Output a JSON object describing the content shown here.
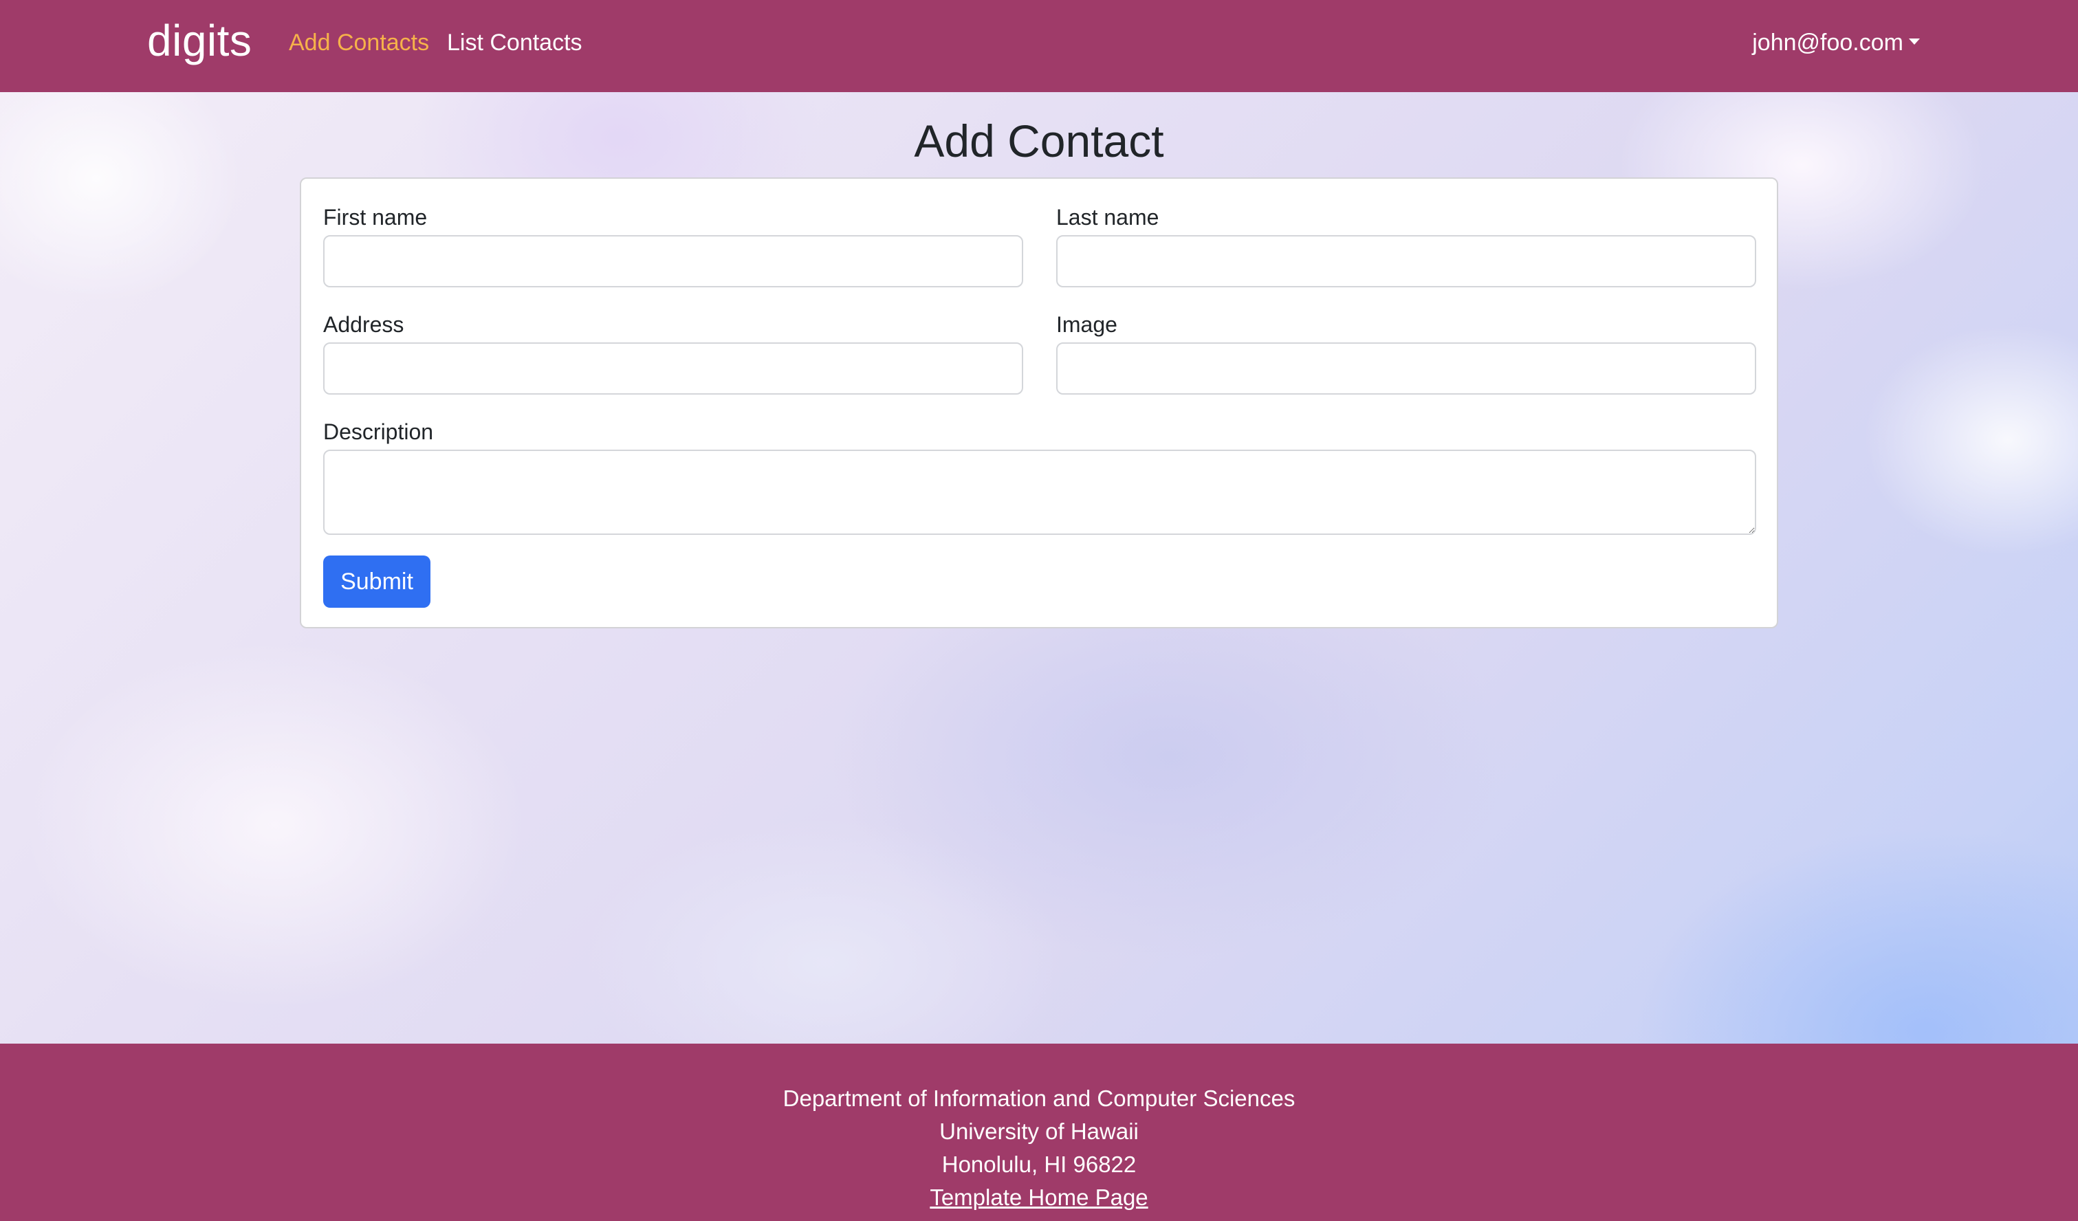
{
  "navbar": {
    "brand": "digits",
    "links": [
      {
        "label": "Add Contacts",
        "active": true
      },
      {
        "label": "List Contacts",
        "active": false
      }
    ],
    "user": "john@foo.com"
  },
  "page": {
    "title": "Add Contact"
  },
  "form": {
    "first_name": {
      "label": "First name",
      "value": ""
    },
    "last_name": {
      "label": "Last name",
      "value": ""
    },
    "address": {
      "label": "Address",
      "value": ""
    },
    "image": {
      "label": "Image",
      "value": ""
    },
    "description": {
      "label": "Description",
      "value": ""
    },
    "submit_label": "Submit"
  },
  "footer": {
    "line1": "Department of Information and Computer Sciences",
    "line2": "University of Hawaii",
    "line3": "Honolulu, HI 96822",
    "link": "Template Home Page"
  },
  "colors": {
    "brand_bar": "#9f3b69",
    "active_link": "#f6b24a",
    "primary_button": "#2f6ff2"
  }
}
